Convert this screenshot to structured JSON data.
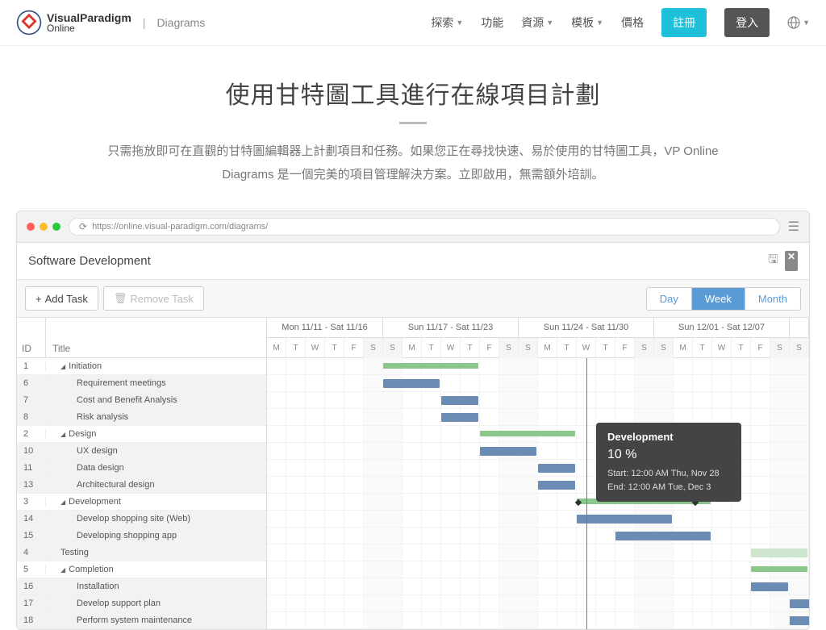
{
  "nav": {
    "brand_top": "VisualParadigm",
    "brand_bottom": "Online",
    "sub": "Diagrams",
    "links": {
      "explore": "探索",
      "features": "功能",
      "resources": "資源",
      "templates": "模板",
      "pricing": "價格"
    },
    "register": "註冊",
    "login": "登入"
  },
  "hero": {
    "title": "使用甘特圖工具進行在線項目計劃",
    "desc": "只需拖放即可在直觀的甘特圖編輯器上計劃項目和任務。如果您正在尋找快速、易於使用的甘特圖工具，VP Online Diagrams 是一個完美的項目管理解決方案。立即啟用，無需額外培訓。"
  },
  "browser": {
    "url": "https://online.visual-paradigm.com/diagrams/"
  },
  "app": {
    "title": "Software Development",
    "add_task": "Add Task",
    "remove_task": "Remove Task",
    "views": {
      "day": "Day",
      "week": "Week",
      "month": "Month"
    }
  },
  "gantt": {
    "col_id": "ID",
    "col_title": "Title",
    "weeks": [
      {
        "label": "Mon 11/11 - Sat 11/16",
        "days": 6
      },
      {
        "label": "Sun 11/17 - Sat 11/23",
        "days": 7
      },
      {
        "label": "Sun 11/24 - Sat 11/30",
        "days": 7
      },
      {
        "label": "Sun 12/01 - Sat 12/07",
        "days": 7
      },
      {
        "label": "",
        "days": 1
      }
    ],
    "day_labels": [
      "M",
      "T",
      "W",
      "T",
      "F",
      "S",
      "S",
      "M",
      "T",
      "W",
      "T",
      "F",
      "S",
      "S",
      "M",
      "T",
      "W",
      "T",
      "F",
      "S",
      "S",
      "M",
      "T",
      "W",
      "T",
      "F",
      "S",
      "S"
    ],
    "weekend_idx": [
      5,
      6,
      12,
      13,
      19,
      20,
      26,
      27
    ],
    "today_idx": 16,
    "tasks": [
      {
        "id": "1",
        "title": "Initiation",
        "indent": 1,
        "collapse": true,
        "type": "summary",
        "start": 6,
        "len": 5
      },
      {
        "id": "6",
        "title": "Requirement meetings",
        "indent": 2,
        "type": "task",
        "start": 6,
        "len": 3
      },
      {
        "id": "7",
        "title": "Cost and Benefit Analysis",
        "indent": 2,
        "type": "task",
        "start": 9,
        "len": 2
      },
      {
        "id": "8",
        "title": "Risk analysis",
        "indent": 2,
        "type": "task",
        "start": 9,
        "len": 2
      },
      {
        "id": "2",
        "title": "Design",
        "indent": 1,
        "collapse": true,
        "type": "summary",
        "start": 11,
        "len": 5
      },
      {
        "id": "10",
        "title": "UX design",
        "indent": 2,
        "type": "task",
        "start": 11,
        "len": 3
      },
      {
        "id": "11",
        "title": "Data design",
        "indent": 2,
        "type": "task",
        "start": 14,
        "len": 2
      },
      {
        "id": "13",
        "title": "Architectural design",
        "indent": 2,
        "type": "task",
        "start": 14,
        "len": 2
      },
      {
        "id": "3",
        "title": "Development",
        "indent": 1,
        "collapse": true,
        "type": "summary",
        "start": 16,
        "len": 7,
        "progress": true
      },
      {
        "id": "14",
        "title": "Develop shopping site (Web)",
        "indent": 2,
        "type": "task",
        "start": 16,
        "len": 5
      },
      {
        "id": "15",
        "title": "Developing shopping app",
        "indent": 2,
        "type": "task",
        "start": 18,
        "len": 5
      },
      {
        "id": "4",
        "title": "Testing",
        "indent": 1,
        "type": "light",
        "start": 25,
        "len": 3
      },
      {
        "id": "5",
        "title": "Completion",
        "indent": 1,
        "collapse": true,
        "type": "summary",
        "start": 25,
        "len": 3
      },
      {
        "id": "16",
        "title": "Installation",
        "indent": 2,
        "type": "task",
        "start": 25,
        "len": 2
      },
      {
        "id": "17",
        "title": "Develop support plan",
        "indent": 2,
        "type": "task",
        "start": 27,
        "len": 2
      },
      {
        "id": "18",
        "title": "Perform system maintenance",
        "indent": 2,
        "type": "task",
        "start": 27,
        "len": 2
      }
    ]
  },
  "tooltip": {
    "title": "Development",
    "pct": "10 %",
    "start": "Start: 12:00 AM Thu, Nov 28",
    "end": "End: 12:00 AM Tue, Dec 3"
  }
}
